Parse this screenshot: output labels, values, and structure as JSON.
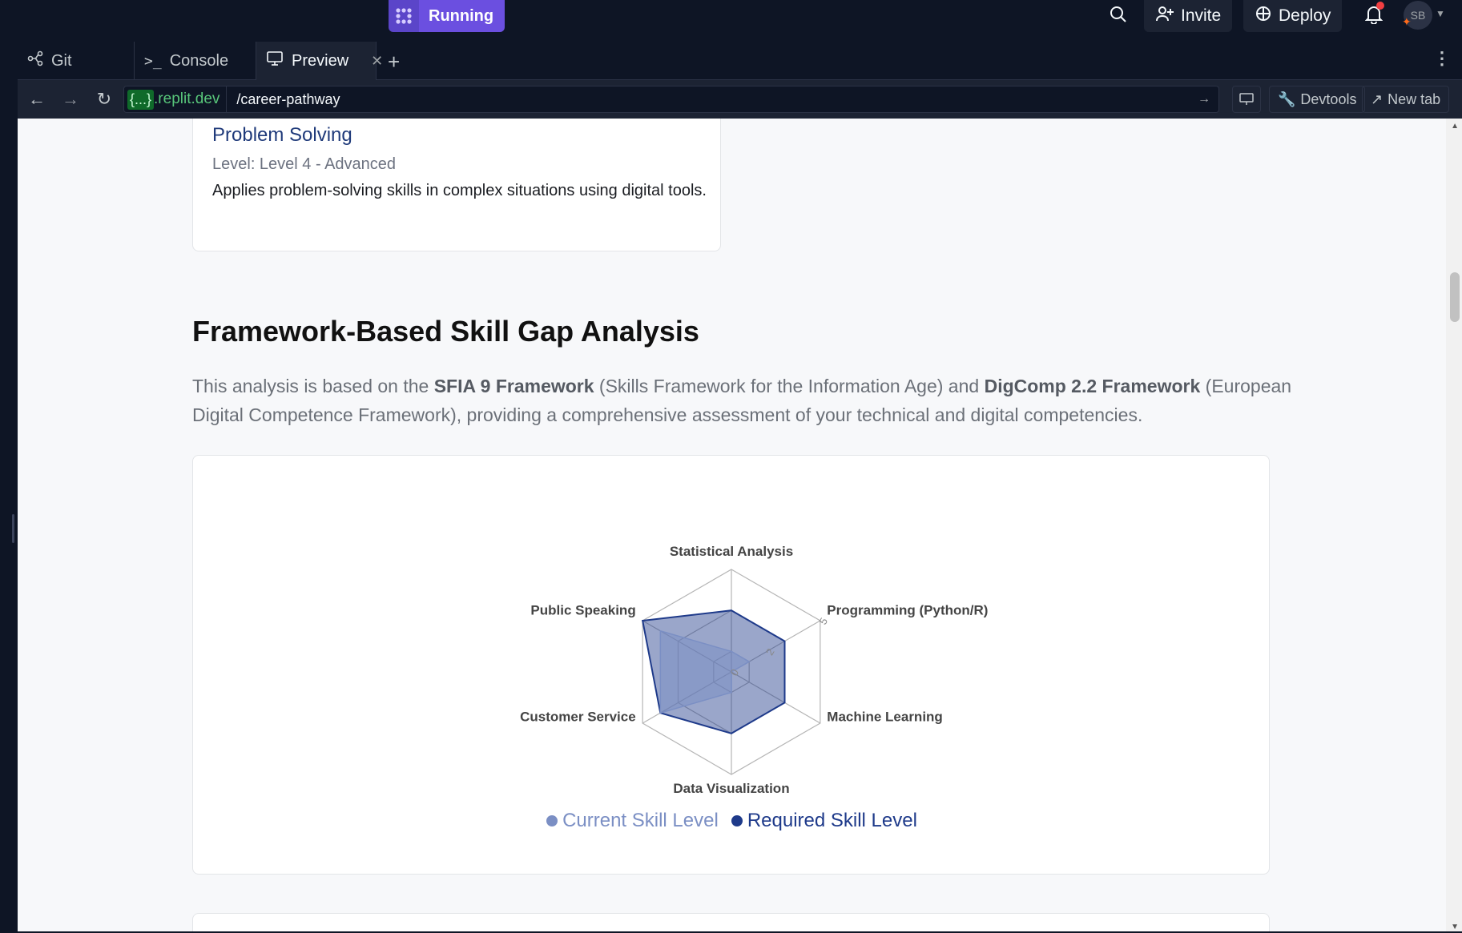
{
  "topbar": {
    "run_label": "Running",
    "invite_label": "Invite",
    "deploy_label": "Deploy",
    "avatar_initials": "SB"
  },
  "tabs": [
    {
      "label": "Git",
      "icon": "git-icon"
    },
    {
      "label": "Console",
      "icon": "console-icon"
    },
    {
      "label": "Preview",
      "icon": "monitor-icon"
    }
  ],
  "urlbar": {
    "domain_braces": "{...}",
    "domain_suffix": ".replit.dev",
    "path": "/career-pathway",
    "devtools_label": "Devtools",
    "newtab_label": "New tab"
  },
  "skill_card": {
    "title": "Problem Solving",
    "level": "Level: Level 4 - Advanced",
    "description": "Applies problem-solving skills in complex situations using digital tools."
  },
  "section": {
    "title": "Framework-Based Skill Gap Analysis",
    "desc_part1": "This analysis is based on the ",
    "desc_bold1": "SFIA 9 Framework",
    "desc_part2": " (Skills Framework for the Information Age) and ",
    "desc_bold2": "DigComp 2.2 Framework",
    "desc_part3": " (European Digital Competence Framework), providing a comprehensive assessment of your technical and digital competencies."
  },
  "chart_data": {
    "type": "radar",
    "categories": [
      "Statistical Analysis",
      "Programming (Python/R)",
      "Machine Learning",
      "Data Visualization",
      "Customer Service",
      "Public Speaking"
    ],
    "series": [
      {
        "name": "Current Skill Level",
        "values": [
          1,
          1,
          0,
          1,
          4,
          4
        ],
        "color": "#7b8fc4"
      },
      {
        "name": "Required Skill Level",
        "values": [
          3,
          3,
          3,
          3,
          4,
          5
        ],
        "color": "#1e3a8a"
      }
    ],
    "rlim": [
      0,
      5
    ],
    "tick_labels": [
      "0",
      "2",
      "5"
    ],
    "legend_position": "bottom"
  },
  "colors": {
    "accent": "#6b4fe0",
    "chart_fill": "#7b8fc4",
    "chart_line": "#1e3a8a"
  }
}
